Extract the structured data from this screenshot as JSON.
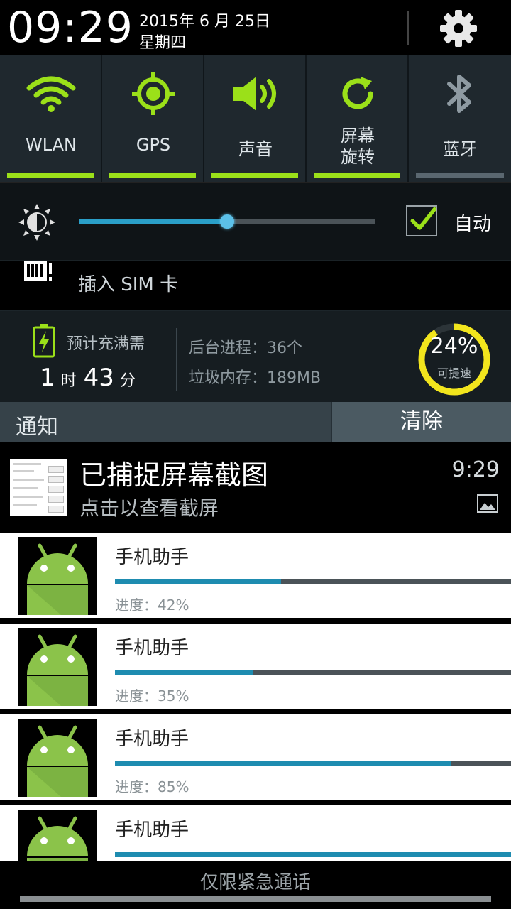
{
  "header": {
    "time": "09:29",
    "date": "2015年 6 月 25日",
    "weekday": "星期四"
  },
  "toggles": [
    {
      "label": "WLAN",
      "icon": "wifi-icon",
      "on": true
    },
    {
      "label": "GPS",
      "icon": "gps-icon",
      "on": true
    },
    {
      "label": "声音",
      "icon": "sound-icon",
      "on": true
    },
    {
      "label_line1": "屏幕",
      "label_line2": "旋转",
      "icon": "rotate-icon",
      "on": true
    },
    {
      "label": "蓝牙",
      "icon": "bluetooth-icon",
      "on": false
    }
  ],
  "brightness": {
    "level": 0.5,
    "auto_label": "自动",
    "auto_checked": true
  },
  "sim": {
    "text": "插入 SIM 卡"
  },
  "battery_panel": {
    "charge_label": "预计充满需",
    "hours": "1",
    "hours_unit": "时",
    "minutes": "43",
    "minutes_unit": "分",
    "processes": "后台进程：36个",
    "junk_memory": "垃圾内存：189MB",
    "boost_percent": "24%",
    "boost_value": 24,
    "boost_label": "可提速"
  },
  "notifications": {
    "title": "通知",
    "clear_label": "清除",
    "screenshot": {
      "title": "已捕捉屏幕截图",
      "subtitle": "点击以查看截屏",
      "time": "9:29"
    },
    "downloads": [
      {
        "name": "手机助手",
        "progress_text": "进度：42%",
        "progress": 42
      },
      {
        "name": "手机助手",
        "progress_text": "进度：35%",
        "progress": 35
      },
      {
        "name": "手机助手",
        "progress_text": "进度：85%",
        "progress": 85
      },
      {
        "name": "手机助手",
        "progress_text": "",
        "progress": 100
      }
    ]
  },
  "footer": {
    "emergency": "仅限紧急通话"
  },
  "colors": {
    "toggle_on": "#9be019",
    "toggle_off": "#5a6770",
    "accent_blue": "#2a9fc8",
    "gauge": "#f2e51d"
  }
}
